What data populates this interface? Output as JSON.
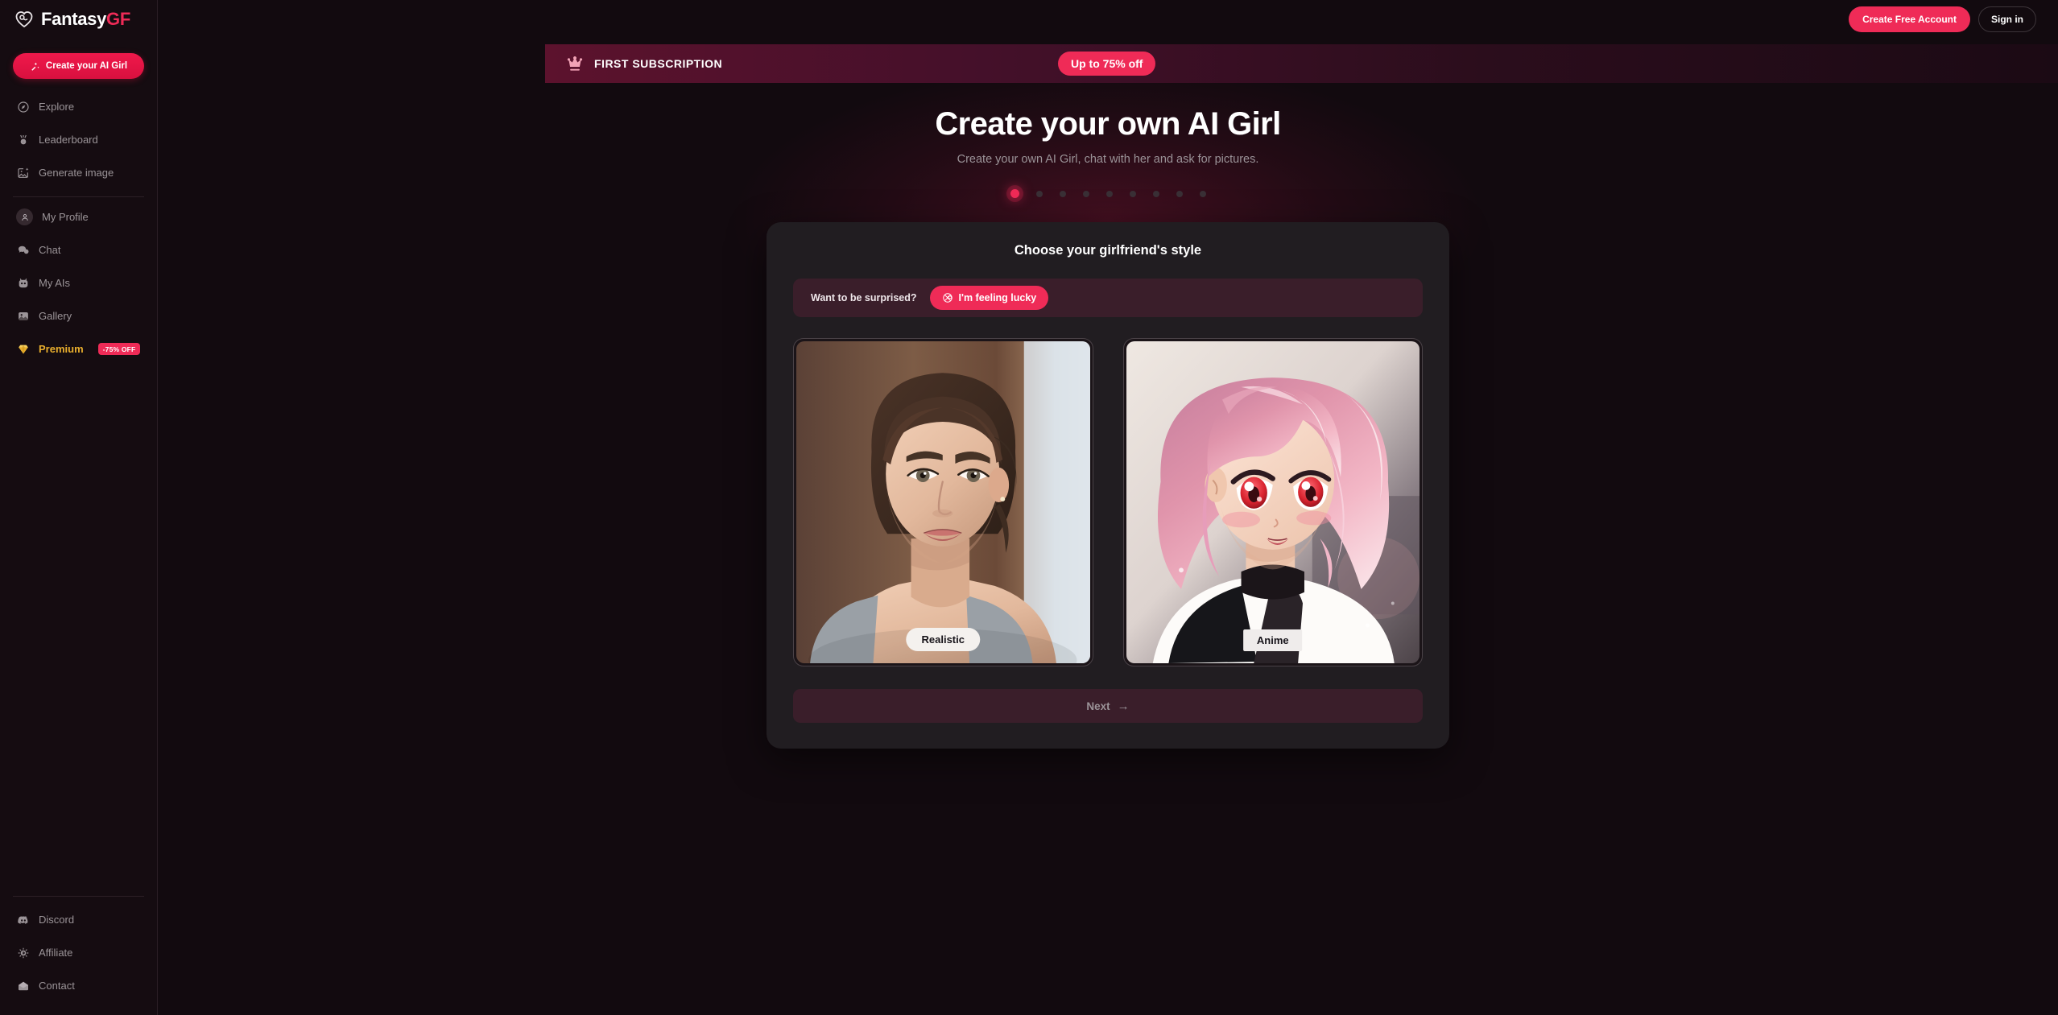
{
  "brand": {
    "name_white": "Fantasy",
    "name_accent": "GF",
    "icon": "heart-logo-icon"
  },
  "topbar": {
    "create_account_label": "Create Free Account",
    "signin_label": "Sign in"
  },
  "sidebar": {
    "cta": {
      "label": "Create your AI Girl",
      "icon": "magic-wand-icon"
    },
    "primary_items": [
      {
        "label": "Explore",
        "icon": "compass-icon"
      },
      {
        "label": "Leaderboard",
        "icon": "medal-icon"
      },
      {
        "label": "Generate image",
        "icon": "image-sparkle-icon"
      }
    ],
    "account_items": [
      {
        "label": "My Profile",
        "icon": "user-avatar-icon"
      },
      {
        "label": "Chat",
        "icon": "chat-bubble-icon"
      },
      {
        "label": "My AIs",
        "icon": "robot-icon"
      },
      {
        "label": "Gallery",
        "icon": "gallery-icon"
      }
    ],
    "premium": {
      "label": "Premium",
      "icon": "diamond-icon",
      "badge": "-75% OFF"
    },
    "bottom_items": [
      {
        "label": "Discord",
        "icon": "discord-icon"
      },
      {
        "label": "Affiliate",
        "icon": "affiliate-coin-icon"
      },
      {
        "label": "Contact",
        "icon": "envelope-icon"
      }
    ]
  },
  "promo": {
    "icon": "crown-icon",
    "title": "FIRST SUBSCRIPTION",
    "pill_label": "Up to 75% off"
  },
  "hero": {
    "title": "Create your own AI Girl",
    "subtitle": "Create your own AI Girl, chat with her and ask for pictures."
  },
  "stepper": {
    "total": 9,
    "active_index": 0
  },
  "card": {
    "title": "Choose your girlfriend's style",
    "surprise": {
      "question": "Want to be surprised?",
      "button_label": "I'm feeling lucky",
      "button_icon": "clover-icon"
    },
    "styles": [
      {
        "label": "Realistic",
        "art": "photo-portrait-woman"
      },
      {
        "label": "Anime",
        "art": "anime-portrait-pink-hair"
      }
    ],
    "next": {
      "label": "Next",
      "icon": "arrow-right-icon"
    }
  },
  "colors": {
    "accent": "#ef2b57",
    "premium_gold": "#e8ae2d",
    "card_bg": "#211d21",
    "page_bg": "#120a0f",
    "sidebar_bg": "#150c11",
    "muted_maroon": "#3a1e2a"
  }
}
